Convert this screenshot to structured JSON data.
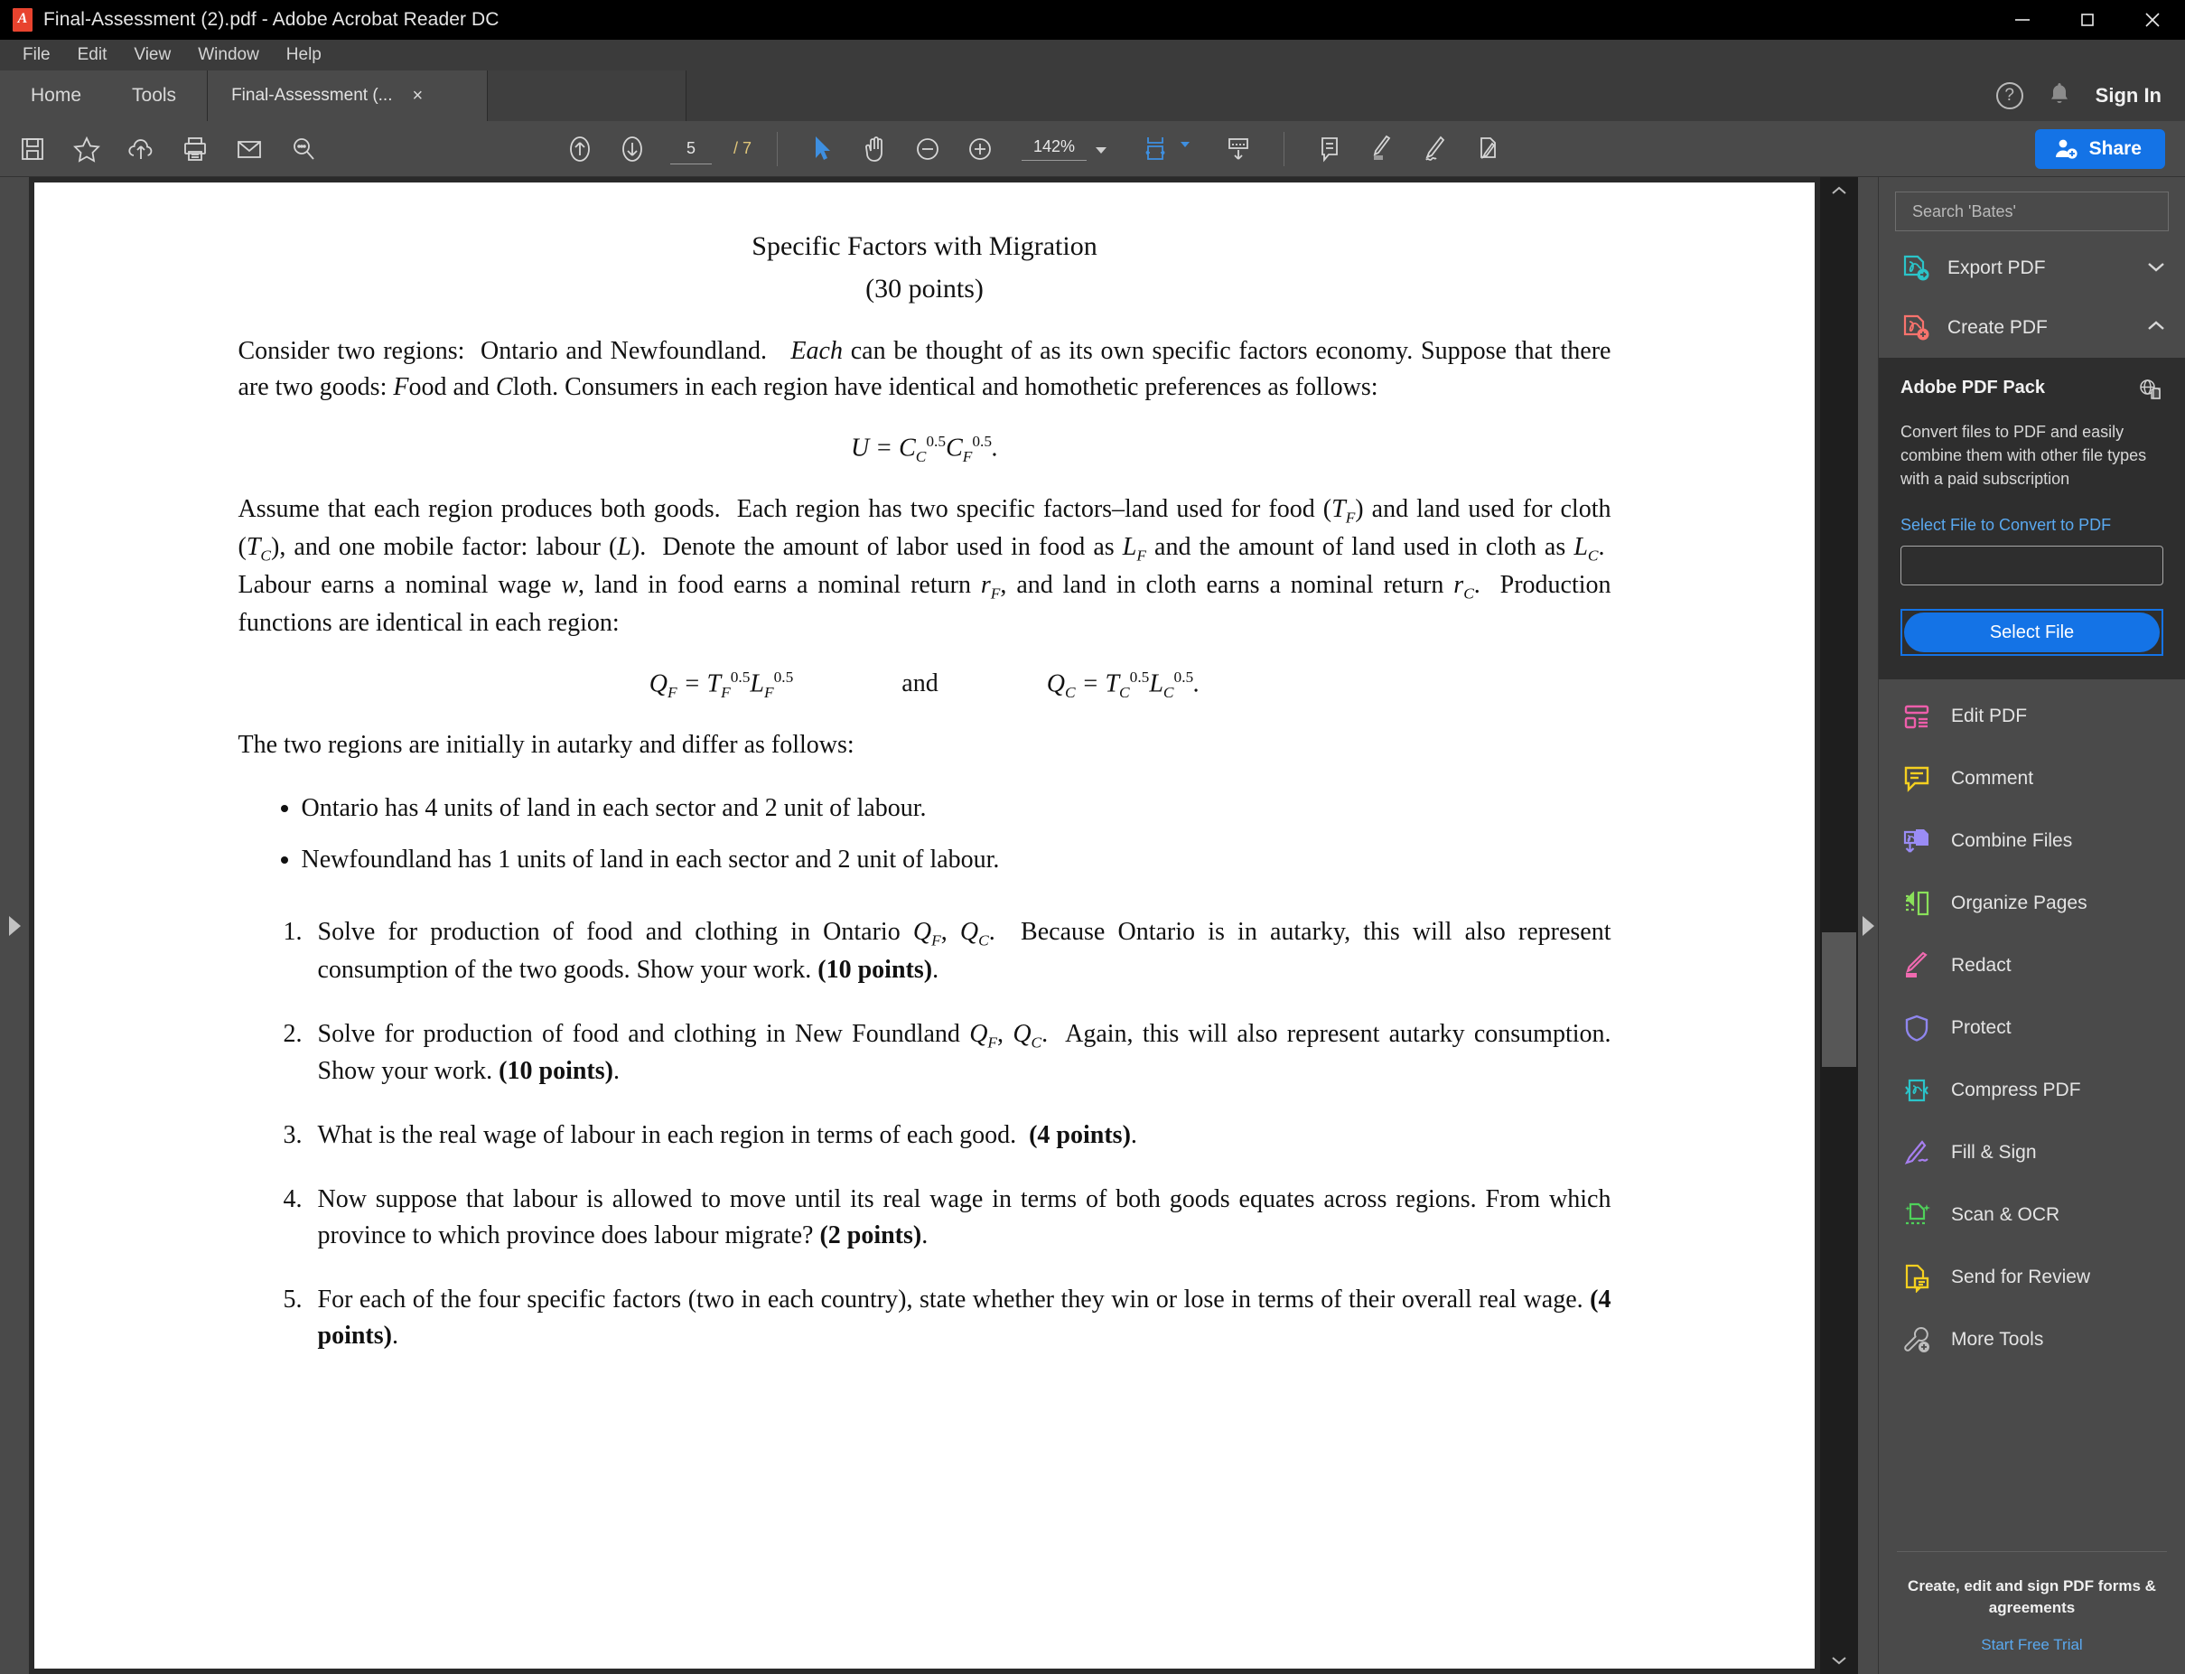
{
  "window": {
    "title": "Final-Assessment (2).pdf - Adobe Acrobat Reader DC",
    "minimize_label": "minimize-icon",
    "maximize_label": "maximize-icon",
    "close_label": "close-icon"
  },
  "menubar": {
    "items": [
      "File",
      "Edit",
      "View",
      "Window",
      "Help"
    ]
  },
  "tabbar": {
    "home": "Home",
    "tools": "Tools",
    "doc_tab": "Final-Assessment (...",
    "doc_tab_close": "×",
    "help": "?",
    "sign_in": "Sign In"
  },
  "toolbar": {
    "left_icons": [
      "save-icon",
      "star-icon",
      "upload-cloud-icon",
      "print-icon",
      "email-icon",
      "search-zoom-icon"
    ],
    "page_current": "5",
    "page_total": "/ 7",
    "zoom_level": "142%",
    "share_label": "Share",
    "center_icons": [
      "previous-page-icon",
      "next-page-icon",
      "select-cursor-icon",
      "hand-tool-icon",
      "zoom-out-icon",
      "zoom-in-icon",
      "fit-page-icon",
      "page-scroll-icon"
    ],
    "annot_icons": [
      "add-comment-icon",
      "highlight-icon",
      "sign-icon",
      "fill-sign-icon"
    ]
  },
  "right_panel": {
    "search_placeholder": "Search 'Bates'",
    "export_pdf": {
      "label": "Export PDF",
      "icon": "export-pdf-icon",
      "chevron": "⌄",
      "color": "#2bc4c9"
    },
    "create_pdf": {
      "label": "Create PDF",
      "icon": "create-pdf-icon",
      "chevron": "⌃",
      "color": "#f8736d"
    },
    "pdf_pack": {
      "title": "Adobe PDF Pack",
      "icon": "globe-document-icon",
      "description": "Convert files to PDF and easily combine them with other file types with a paid subscription",
      "link": "Select File to Convert to PDF",
      "input_value": "",
      "button": "Select File",
      "button_color": "#1473e6"
    },
    "tools": [
      {
        "label": "Edit PDF",
        "icon": "edit-pdf-icon",
        "color": "#ee5eab"
      },
      {
        "label": "Comment",
        "icon": "comment-icon",
        "color": "#f5d020"
      },
      {
        "label": "Combine Files",
        "icon": "combine-files-icon",
        "color": "#9a8cf5"
      },
      {
        "label": "Organize Pages",
        "icon": "organize-pages-icon",
        "color": "#8ae05a"
      },
      {
        "label": "Redact",
        "icon": "redact-icon",
        "color": "#f06ab0"
      },
      {
        "label": "Protect",
        "icon": "protect-shield-icon",
        "color": "#8f86ee"
      },
      {
        "label": "Compress PDF",
        "icon": "compress-pdf-icon",
        "color": "#2bc4c9"
      },
      {
        "label": "Fill & Sign",
        "icon": "fill-sign-icon",
        "color": "#a77ff0"
      },
      {
        "label": "Scan & OCR",
        "icon": "scan-ocr-icon",
        "color": "#4fd25a"
      },
      {
        "label": "Send for Review",
        "icon": "send-review-icon",
        "color": "#f5d020"
      },
      {
        "label": "More Tools",
        "icon": "more-tools-icon",
        "color": "#bdbdbd"
      }
    ],
    "footer": {
      "text": "Create, edit and sign PDF forms & agreements",
      "link": "Start Free Trial"
    }
  },
  "document": {
    "title_line1": "Specific Factors with Migration",
    "title_line2": "(30 points)",
    "para1": "Consider two regions: Ontario and Newfoundland. Each can be thought of as its own specific factors economy. Suppose that there are two goods: Food and Cloth. Consumers in each region have identical and homothetic preferences as follows:",
    "equation1": "U = C_C^{0.5} C_F^{0.5}.",
    "para2": "Assume that each region produces both goods. Each region has two specific factors–land used for food (T_F) and land used for cloth (T_C), and one mobile factor: labour (L). Denote the amount of labor used in food as L_F and the amount of land used in cloth as L_C. Labour earns a nominal wage w, land in food earns a nominal return r_F, and land in cloth earns a nominal return r_C. Production functions are identical in each region:",
    "equation2_left": "Q_F = T_F^{0.5} L_F^{0.5}",
    "equation2_mid": "and",
    "equation2_right": "Q_C = T_C^{0.5} L_C^{0.5}.",
    "para3": "The two regions are initially in autarky and differ as follows:",
    "bullets": [
      "Ontario has 4 units of land in each sector and 2 unit of labour.",
      "Newfoundland has 1 units of land in each sector and 2 unit of labour."
    ],
    "numbered": [
      "Solve for production of food and clothing in Ontario Q_F, Q_C. Because Ontario is in autarky, this will also represent consumption of the two goods. Show your work. (10 points).",
      "Solve for production of food and clothing in New Foundland Q_F, Q_C. Again, this will also represent autarky consumption. Show your work. (10 points).",
      "What is the real wage of labour in each region in terms of each good. (4 points).",
      "Now suppose that labour is allowed to move until its real wage in terms of both goods equates across regions. From which province to which province does labour migrate? (2 points).",
      "For each of the four specific factors (two in each country), state whether they win or lose in terms of their overall real wage. (4 points)."
    ]
  }
}
